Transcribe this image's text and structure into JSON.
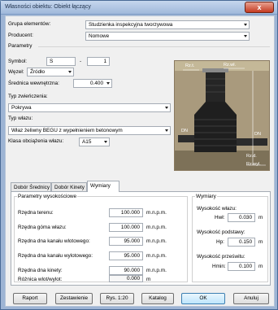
{
  "window": {
    "title": "Własności obiektu: Obiekt łączący",
    "close_label": "x"
  },
  "form": {
    "group_label": "Grupa elementów:",
    "group_value": "Studzienka inspekcyjna tworzywowa",
    "producer_label": "Producent:",
    "producer_value": "Nomowe",
    "params_label": "Parametry",
    "symbol_label": "Symbol:",
    "symbol_prefix": "S",
    "symbol_dash": "-",
    "symbol_number": "1",
    "node_label": "Węzeł:",
    "node_value": "Źródło",
    "diameter_label": "Średnica wewnętrzna:",
    "diameter_value": "0.400",
    "finish_label": "Typ zwieńczenia:",
    "finish_value": "Pokrywa",
    "manhole_label": "Typ włazu:",
    "manhole_value": "Właz żeliwny BEGU z wypełnieniem betonowym",
    "load_label": "Klasa obciążenia włazu:",
    "load_value": "A15"
  },
  "diagram": {
    "label_rz_t": "Rz.t.",
    "label_rz_wl": "Rz.wł.",
    "label_dn_left": "DN",
    "label_dn_right": "DN",
    "label_rz_d": "Rz.d.",
    "label_rz_wyl": "Rz.wyl."
  },
  "tabs": [
    {
      "label": "Dobór Średnicy"
    },
    {
      "label": "Dobór Kinety"
    },
    {
      "label": "Wymiary"
    }
  ],
  "heights": {
    "title": "Parametry wysokościowe",
    "terrain_label": "Rzędna terenu:",
    "terrain_value": "100.000",
    "top_label": "Rzędna góma włazu:",
    "top_value": "100.000",
    "inlet_label": "Rzędna dna kanału wlotowego:",
    "inlet_value": "95.000",
    "outlet_label": "Rzędna dna kanału wylotowego:",
    "outlet_value": "95.000",
    "bed_label": "Rzędna dna kinety:",
    "bed_value": "90.000",
    "diff_label": "Różnica wlot/wylot:",
    "diff_value": "0.000",
    "unit_mnpm": "m.n.p.m.",
    "unit_m": "m"
  },
  "dims": {
    "title": "Wymiary",
    "hatch_label": "Wysokość włazu:",
    "hwl_label": "Hwł:",
    "hwl_value": "0.030",
    "base_label": "Wysokość podstawy:",
    "hp_label": "Hp:",
    "hp_value": "0.150",
    "clear_label": "Wysokość prześwitu:",
    "hmin_label": "Hmin:",
    "hmin_value": "0.100",
    "unit_m": "m"
  },
  "buttons": {
    "report": "Raport",
    "summary": "Zestawienie",
    "figure": "Rys. 1:20",
    "catalog": "Katalog",
    "ok": "OK",
    "cancel": "Anuluj"
  },
  "colors": {
    "title_bar": "#a9c1e0",
    "close_button": "#c53a21",
    "manhole": "#1f1f1f",
    "ground": "#9b8e74",
    "ok_button": "#bee6fd"
  }
}
